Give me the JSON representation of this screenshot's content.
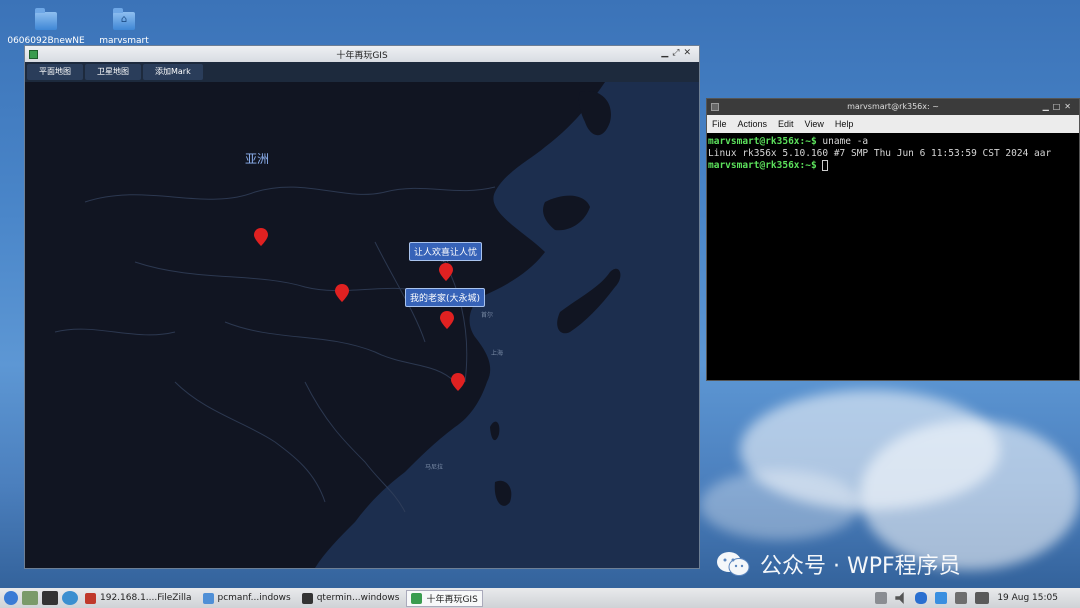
{
  "desktop": {
    "icons": [
      {
        "label": "0606092BnewNE"
      },
      {
        "label": "marvsmart"
      }
    ]
  },
  "gis": {
    "title": "十年再玩GIS",
    "toolbar": [
      "平面地图",
      "卫星地图",
      "添加Mark"
    ],
    "continent_label": "亚洲",
    "markers": [
      {
        "tip": ""
      },
      {
        "tip": ""
      },
      {
        "tip": "让人欢喜让人忧"
      },
      {
        "tip": "我的老家(大永城)"
      },
      {
        "tip": ""
      }
    ],
    "marker_color": "#e02121"
  },
  "terminal": {
    "title": "marvsmart@rk356x: ~",
    "menu": [
      "File",
      "Actions",
      "Edit",
      "View",
      "Help"
    ],
    "lines": [
      {
        "prompt": "marvsmart@rk356x:~$",
        "text": " uname -a"
      },
      {
        "prompt": "",
        "text": "Linux rk356x 5.10.160 #7 SMP Thu Jun 6 11:53:59 CST 2024 aar"
      },
      {
        "prompt": "marvsmart@rk356x:~$",
        "text": " "
      }
    ]
  },
  "watermark": {
    "text": "公众号 · WPF程序员"
  },
  "taskbar": {
    "tasks": [
      {
        "label": "192.168.1....FileZilla",
        "icon": "filezilla-icon",
        "active": false
      },
      {
        "label": "pcmanf...indows",
        "icon": "folder-icon",
        "active": false
      },
      {
        "label": "qtermin...windows",
        "icon": "terminal-icon",
        "active": false
      },
      {
        "label": "十年再玩GIS",
        "icon": "gis-app-icon",
        "active": true
      }
    ],
    "clock": "19 Aug 15:05"
  }
}
